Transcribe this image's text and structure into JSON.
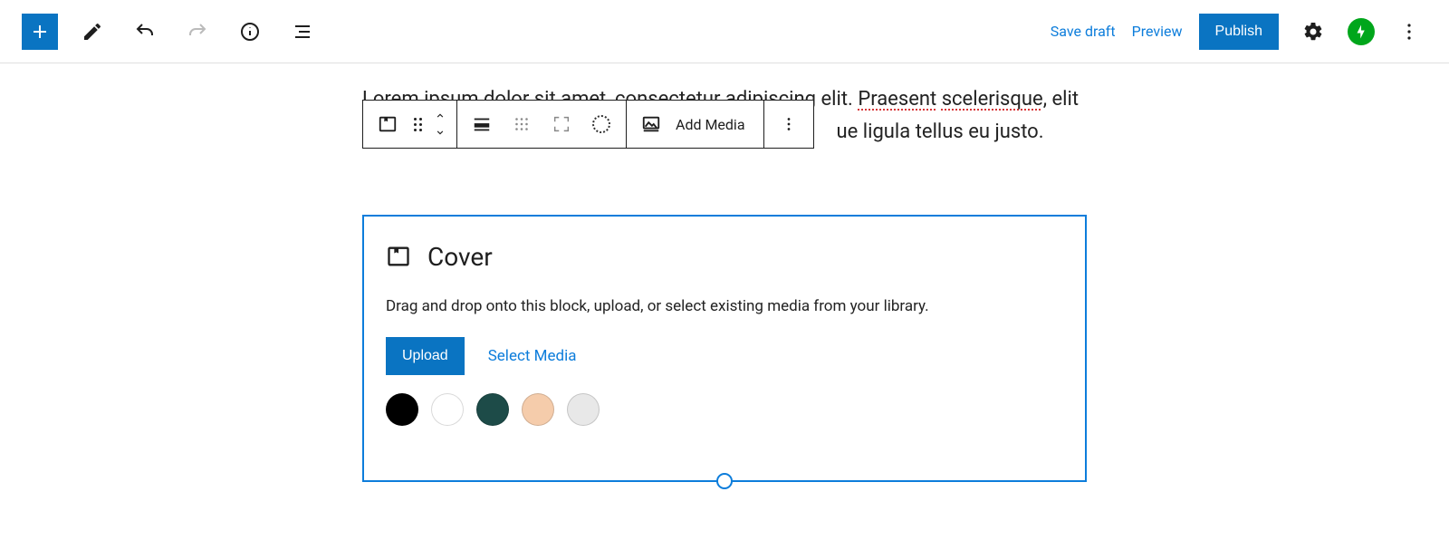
{
  "header": {
    "save_draft": "Save draft",
    "preview": "Preview",
    "publish": "Publish"
  },
  "paragraph": {
    "line1_a": "Lorem ipsum dolor sit amet, consectetur adipiscing elit. ",
    "line1_b": "Praesent",
    "line1_c": " ",
    "line1_d": "scelerisque",
    "line1_e": ", elit",
    "line2_tail": "ue ligula tellus eu justo."
  },
  "toolbar": {
    "add_media": "Add Media"
  },
  "cover": {
    "title": "Cover",
    "description": "Drag and drop onto this block, upload, or select existing media from your library.",
    "upload": "Upload",
    "select_media": "Select Media",
    "swatches": [
      "#000000",
      "#ffffff",
      "#1d4b48",
      "#f5ccab",
      "#e8e8e8"
    ]
  }
}
